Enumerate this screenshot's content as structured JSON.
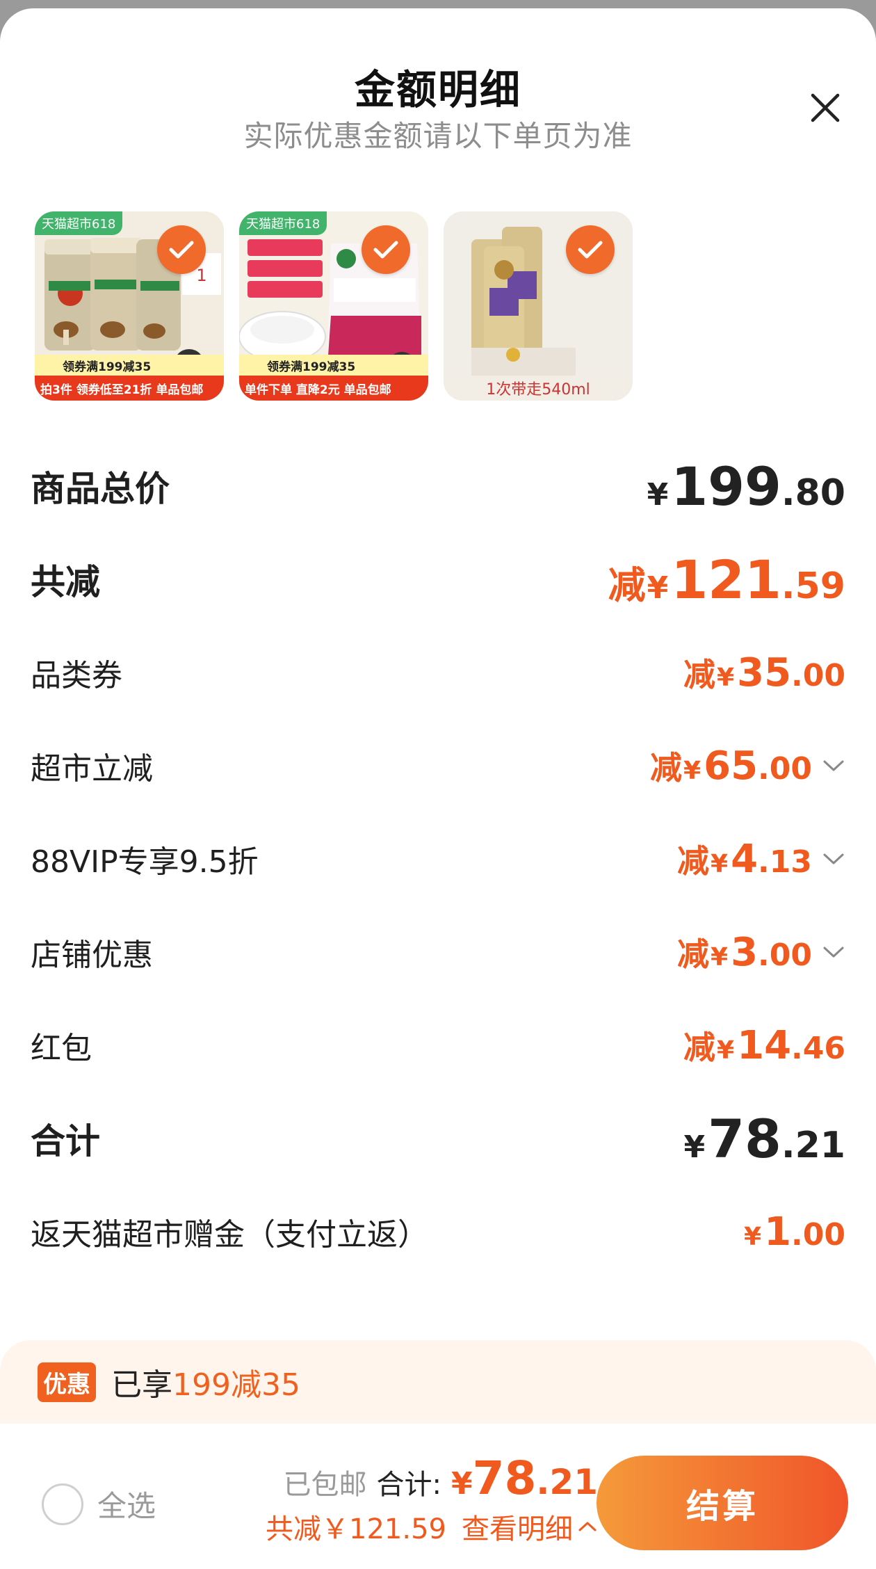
{
  "header": {
    "title": "金额明细",
    "subtitle": "实际优惠金额请以下单页为准"
  },
  "products": [
    {
      "badge": "天猫超市618",
      "promo": "领券满199减35",
      "banner": "拍3件 领券低至21折  单品包邮",
      "image": "mushroom-seasoning-jars"
    },
    {
      "badge": "天猫超市618",
      "promo": "领券满199减35",
      "banner": "单件下单 直降2元  单品包邮",
      "image": "msg-seasoning-bag"
    },
    {
      "badge": "",
      "promo": "",
      "banner": "1次带走540ml",
      "image": "shampoo-tubes"
    }
  ],
  "rows": [
    {
      "label": "商品总价",
      "prefix": "",
      "yen": "¥",
      "int": "199",
      "dec": ".80",
      "style": "big-dark",
      "chevron": false
    },
    {
      "label": "共减",
      "prefix": "减",
      "yen": "¥",
      "int": "121",
      "dec": ".59",
      "style": "big-orange",
      "chevron": false
    },
    {
      "label": "品类券",
      "prefix": "减",
      "yen": "¥",
      "int": "35",
      "dec": ".00",
      "style": "small-orange",
      "chevron": false
    },
    {
      "label": "超市立减",
      "prefix": "减",
      "yen": "¥",
      "int": "65",
      "dec": ".00",
      "style": "small-orange",
      "chevron": true
    },
    {
      "label": "88VIP专享9.5折",
      "prefix": "减",
      "yen": "¥",
      "int": "4",
      "dec": ".13",
      "style": "small-orange",
      "chevron": true
    },
    {
      "label": "店铺优惠",
      "prefix": "减",
      "yen": "¥",
      "int": "3",
      "dec": ".00",
      "style": "small-orange",
      "chevron": true
    },
    {
      "label": "红包",
      "prefix": "减",
      "yen": "¥",
      "int": "14",
      "dec": ".46",
      "style": "small-orange",
      "chevron": false
    },
    {
      "label": "合计",
      "prefix": "",
      "yen": "¥",
      "int": "78",
      "dec": ".21",
      "style": "big-dark",
      "chevron": false
    },
    {
      "label": "返天猫超市赠金（支付立返）",
      "prefix": "",
      "yen": "¥",
      "int": "1",
      "dec": ".00",
      "style": "small-orange",
      "chevron": false
    }
  ],
  "promo": {
    "badge": "优惠",
    "text": "已享",
    "highlight": "199减35"
  },
  "footer": {
    "select_all": "全选",
    "shipped": "已包邮",
    "total_label": "合计:",
    "total_yen": "¥",
    "total_int": "78",
    "total_dec": ".21",
    "saved": "共减￥121.59",
    "detail": "查看明细",
    "checkout": "结算"
  },
  "colors": {
    "accent": "#f05a1e",
    "checkout_gradient_start": "#f59a3a",
    "checkout_gradient_end": "#f0552a"
  }
}
